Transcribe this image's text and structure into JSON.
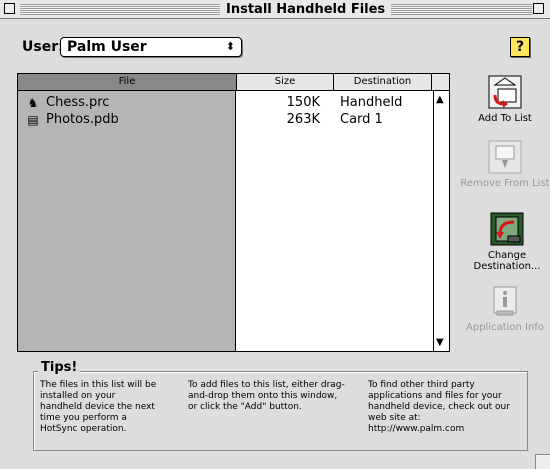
{
  "window": {
    "title": "Install Handheld Files"
  },
  "user": {
    "label": "User:",
    "value": "Palm User",
    "popup_arrows": "⬍"
  },
  "help": {
    "label": "?"
  },
  "table": {
    "columns": {
      "file": "File",
      "size": "Size",
      "destination": "Destination"
    },
    "rows": [
      {
        "icon": "chess-app-icon",
        "name": "Chess.prc",
        "size": "150K",
        "destination": "Handheld"
      },
      {
        "icon": "database-file-icon",
        "name": "Photos.pdb",
        "size": "263K",
        "destination": "Card 1"
      }
    ]
  },
  "actions": {
    "add": "Add To List",
    "remove": "Remove From List",
    "change": "Change Destination...",
    "info": "Application Info"
  },
  "tips": {
    "title": "Tips!",
    "col1": "The files in this list will be installed on your handheld device the next time you perform a HotSync operation.",
    "col2": "To add files to this list, either drag-and-drop them onto this window, or click the \"Add\" button.",
    "col3": "To find other third party applications and files for your handheld device, check out our web site at: http://www.palm.com"
  },
  "colors": {
    "accent_red": "#d81818",
    "help_yellow": "#ffe65a",
    "disabled_text": "#999999"
  }
}
